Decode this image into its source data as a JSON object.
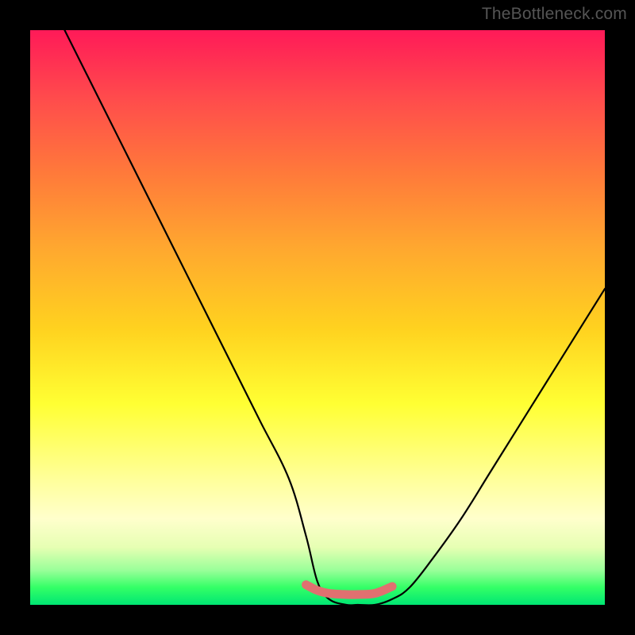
{
  "watermark": "TheBottleneck.com",
  "chart_data": {
    "type": "line",
    "title": "",
    "xlabel": "",
    "ylabel": "",
    "xlim": [
      0,
      100
    ],
    "ylim": [
      0,
      100
    ],
    "series": [
      {
        "name": "bottleneck-curve",
        "x": [
          6,
          10,
          15,
          20,
          25,
          30,
          35,
          40,
          45,
          48,
          50,
          52,
          55,
          57,
          60,
          63,
          66,
          70,
          75,
          80,
          85,
          90,
          95,
          100
        ],
        "values": [
          100,
          92,
          82,
          72,
          62,
          52,
          42,
          32,
          22,
          12,
          4,
          1,
          0,
          0,
          0,
          1,
          3,
          8,
          15,
          23,
          31,
          39,
          47,
          55
        ]
      },
      {
        "name": "optimal-band",
        "x": [
          48,
          50,
          52,
          55,
          57,
          60,
          63
        ],
        "values": [
          3.5,
          2.5,
          2.0,
          1.8,
          1.8,
          2.0,
          3.2
        ]
      }
    ],
    "background_gradient": {
      "top_color": "#ff1a58",
      "mid_color": "#ffff33",
      "bottom_color": "#00e673"
    },
    "curve_color": "#000000",
    "band_color": "#e07070"
  }
}
